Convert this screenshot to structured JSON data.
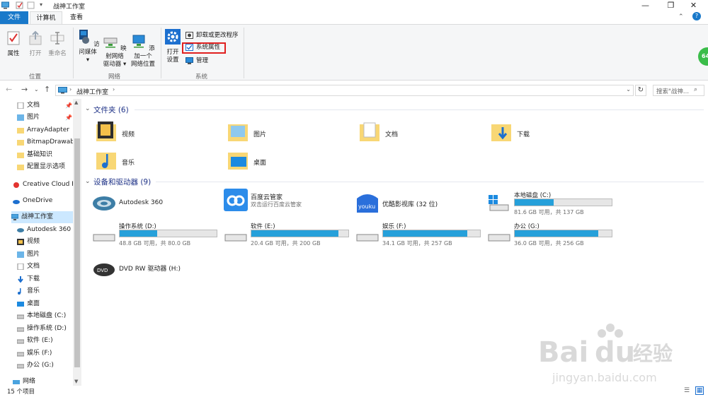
{
  "window": {
    "title": "战神工作室",
    "controls": [
      "—",
      "❐",
      "✕"
    ]
  },
  "tabs": [
    {
      "label": "文件"
    },
    {
      "label": "计算机"
    },
    {
      "label": "查看"
    }
  ],
  "ribbon": {
    "location_group": {
      "label": "位置",
      "buttons": [
        "属性",
        "打开",
        "重命名"
      ]
    },
    "network_group": {
      "label": "网络",
      "buttons": [
        [
          "访问媒体",
          ""
        ],
        [
          "映射网络",
          "驱动器"
        ],
        [
          "添加一个",
          "网络位置"
        ]
      ]
    },
    "system_group": {
      "label": "系统",
      "open_settings": [
        "打开",
        "设置"
      ],
      "uninstall": "卸载或更改程序",
      "system_properties": "系统属性",
      "manage": "管理"
    }
  },
  "address": {
    "path": "战神工作室",
    "search_placeholder": "搜索\"战神..."
  },
  "sidebar": {
    "quick": [
      {
        "label": "文档",
        "pinned": true
      },
      {
        "label": "图片",
        "pinned": true
      },
      {
        "label": "ArrayAdapter",
        "pinned": false
      },
      {
        "label": "BitmapDrawab",
        "pinned": false
      },
      {
        "label": "基础知识",
        "pinned": false
      },
      {
        "label": "配置显示选项",
        "pinned": false
      }
    ],
    "creative_cloud": "Creative Cloud F",
    "onedrive": "OneDrive",
    "this_pc": "战神工作室",
    "pc_items": [
      "Autodesk 360",
      "视频",
      "图片",
      "文档",
      "下载",
      "音乐",
      "桌面",
      "本地磁盘 (C:)",
      "操作系统 (D:)",
      "软件 (E:)",
      "娱乐 (F:)",
      "办公 (G:)"
    ],
    "network": "网络"
  },
  "folders_header": "文件夹 (6)",
  "folders": [
    "视频",
    "图片",
    "文档",
    "下载",
    "音乐",
    "桌面"
  ],
  "devices_header": "设备和驱动器 (9)",
  "apps": [
    {
      "name": "Autodesk 360",
      "sub": ""
    },
    {
      "name": "百度云管家",
      "sub": "双击运行百度云管家"
    },
    {
      "name": "优酷影视库 (32 位)",
      "sub": ""
    }
  ],
  "drives": [
    {
      "name": "本地磁盘 (C:)",
      "free": "81.6 GB 可用，共 137 GB",
      "used_fraction": 0.4
    },
    {
      "name": "操作系统 (D:)",
      "free": "48.8 GB 可用，共 80.0 GB",
      "used_fraction": 0.39
    },
    {
      "name": "软件 (E:)",
      "free": "20.4 GB 可用，共 200 GB",
      "used_fraction": 0.9
    },
    {
      "name": "娱乐 (F:)",
      "free": "34.1 GB 可用，共 257 GB",
      "used_fraction": 0.87
    },
    {
      "name": "办公 (G:)",
      "free": "36.0 GB 可用，共 256 GB",
      "used_fraction": 0.86
    }
  ],
  "dvd": {
    "name": "DVD RW 驱动器 (H:)"
  },
  "status": {
    "count": "15 个项目"
  },
  "watermark": {
    "brand": "Bai",
    "brand2": "du",
    "cn": "经验",
    "url": "jingyan.baidu.com"
  },
  "colors": {
    "accent": "#1979ca",
    "drive_fill": "#26a0da",
    "highlight": "#e02020"
  }
}
